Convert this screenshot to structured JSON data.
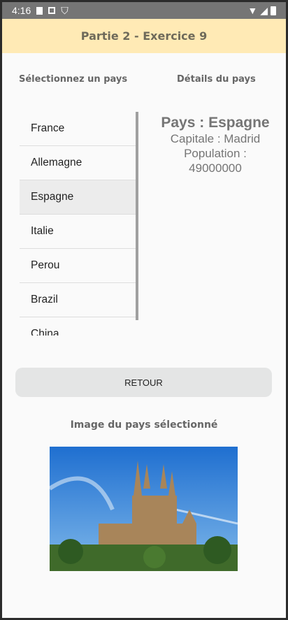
{
  "status": {
    "time": "4:16"
  },
  "appbar": {
    "title": "Partie 2 - Exercice 9"
  },
  "headings": {
    "select": "Sélectionnez un pays",
    "details": "Détails du pays"
  },
  "countries": [
    "France",
    "Allemagne",
    "Espagne",
    "Italie",
    "Perou",
    "Brazil",
    "China"
  ],
  "selected_index": 2,
  "details": {
    "pays": "Pays : Espagne",
    "capitale": "Capitale : Madrid",
    "population_label": "Population :",
    "population": "49000000"
  },
  "button": {
    "label": "RETOUR"
  },
  "image": {
    "caption": "Image du pays sélectionné"
  }
}
